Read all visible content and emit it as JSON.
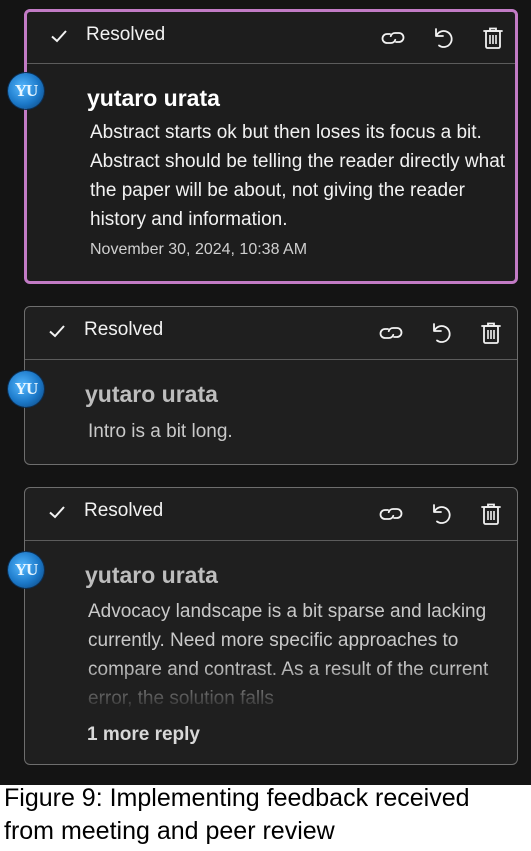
{
  "comments": [
    {
      "status": "Resolved",
      "avatar_text": "YU",
      "author": "yutaro urata",
      "text": " Abstract starts ok but then loses its focus a bit. Abstract should be telling the reader directly what the paper will be about, not giving the reader history and information.",
      "timestamp": "November 30, 2024, 10:38 AM",
      "active": true
    },
    {
      "status": "Resolved",
      "avatar_text": "YU",
      "author": "yutaro urata",
      "text": "Intro is a bit long.",
      "active": false
    },
    {
      "status": "Resolved",
      "avatar_text": "YU",
      "author": "yutaro urata",
      "text": "Advocacy landscape is a bit sparse and lacking currently. Need more specific approaches to compare and contrast. As a result of the current error, the solution falls",
      "more_replies": "1 more reply",
      "active": false
    }
  ],
  "caption": "Figure 9: Implementing feedback received from meeting and peer review",
  "colors": {
    "active_border": "#c27bc5",
    "panel_bg": "#141414",
    "card_bg": "#1f1f1f"
  },
  "icons": [
    "check-icon",
    "link-icon",
    "undo-icon",
    "trash-icon"
  ]
}
